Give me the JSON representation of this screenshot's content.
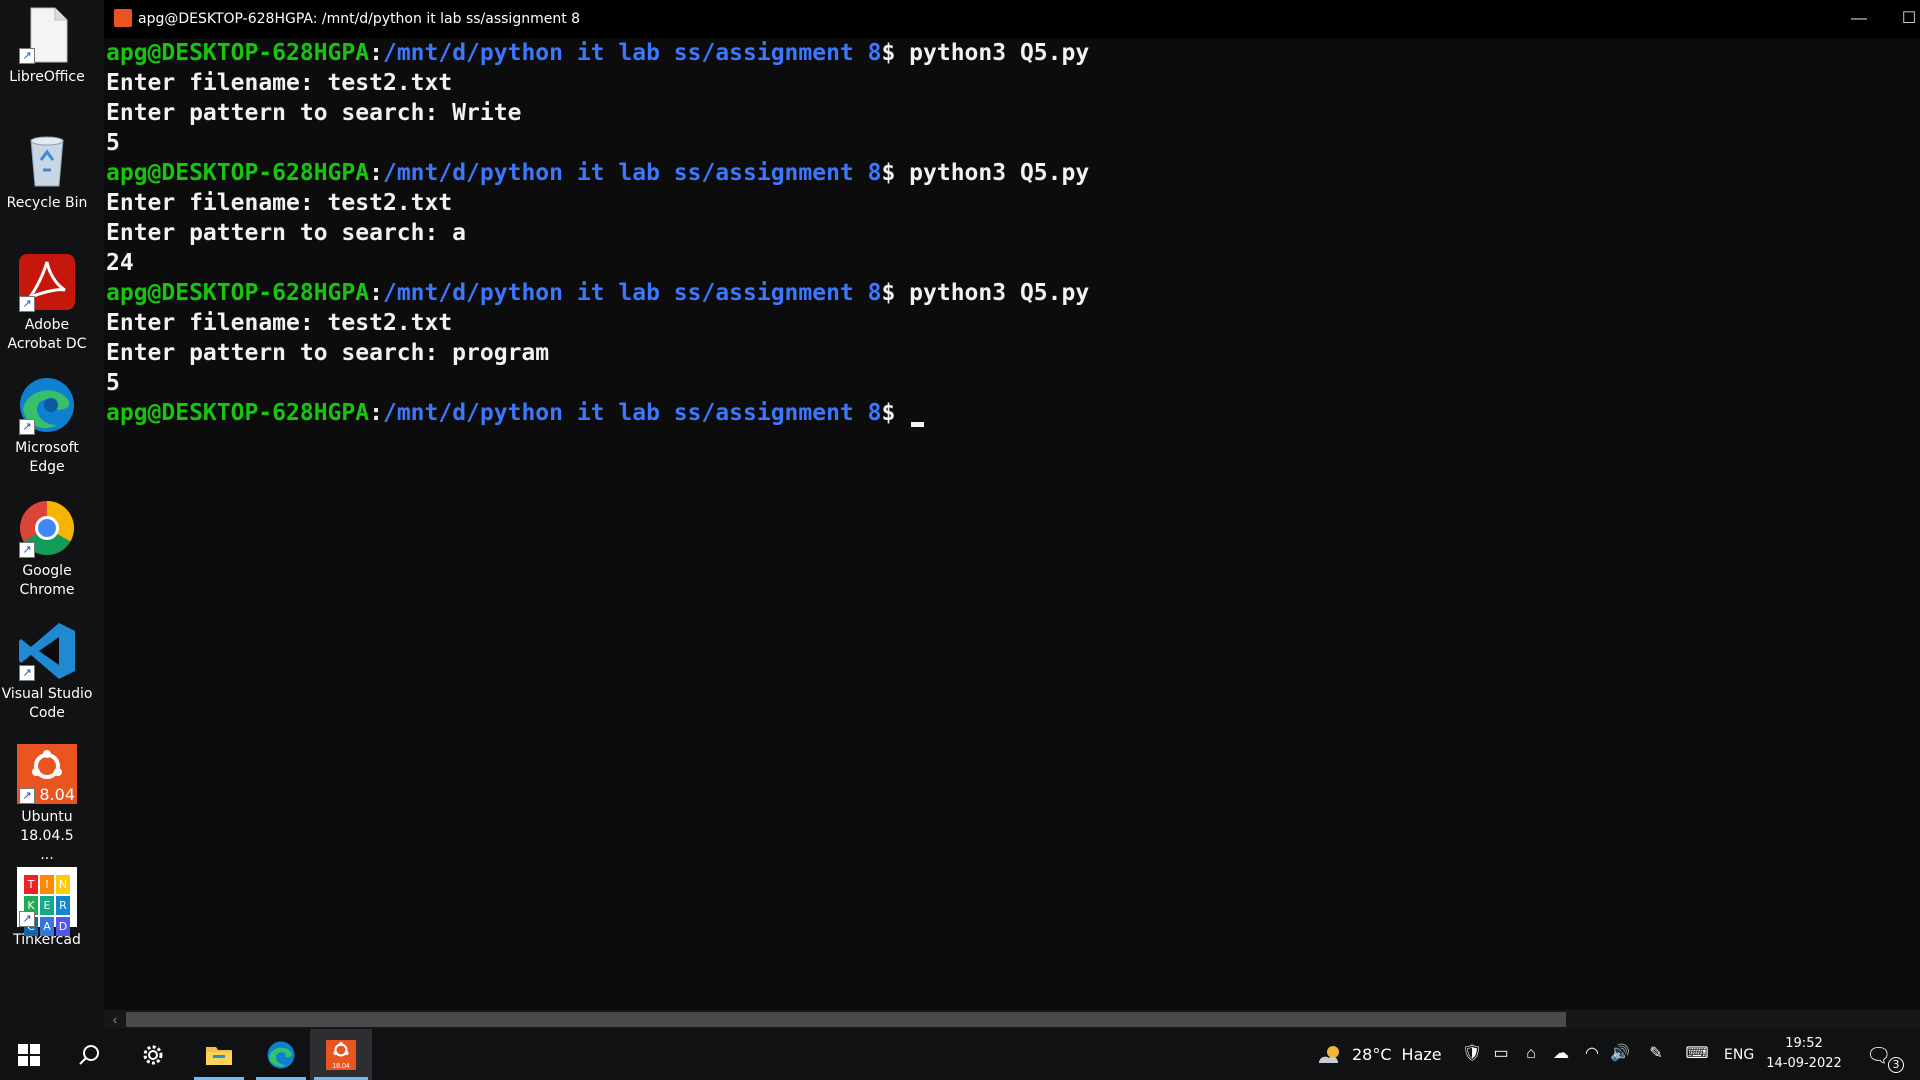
{
  "desktop": {
    "icons": [
      {
        "label": "LibreOffice",
        "icon": "libreoffice-file-icon"
      },
      {
        "label": "Recycle Bin",
        "icon": "recycle-bin-icon"
      },
      {
        "label": "Adobe Acrobat DC",
        "icon": "adobe-acrobat-icon"
      },
      {
        "label": "Microsoft Edge",
        "icon": "edge-icon"
      },
      {
        "label": "Google Chrome",
        "icon": "chrome-icon"
      },
      {
        "label": "Visual Studio Code",
        "icon": "vscode-icon"
      },
      {
        "label": "Ubuntu 18.04.5 ...",
        "icon": "ubuntu-icon",
        "badge": "8.04"
      },
      {
        "label": "Tinkercad",
        "icon": "tinkercad-icon",
        "letters": [
          "T",
          "I",
          "N",
          "K",
          "E",
          "R",
          "C",
          "A",
          "D"
        ]
      }
    ]
  },
  "window": {
    "title": "apg@DESKTOP-628HGPA: /mnt/d/python it lab ss/assignment 8",
    "minimize_glyph": "—",
    "maximize_glyph": "☐"
  },
  "terminal": {
    "prompt_user": "apg@DESKTOP-628HGPA",
    "prompt_sep": ":",
    "prompt_path": "/mnt/d/python it lab ss/assignment 8",
    "prompt_sym": "$ ",
    "command": "python3 Q5.py",
    "runs": [
      {
        "filename_line": "Enter filename: test2.txt",
        "pattern_line": "Enter pattern to search: Write",
        "result": "5"
      },
      {
        "filename_line": "Enter filename: test2.txt",
        "pattern_line": "Enter pattern to search: a",
        "result": "24"
      },
      {
        "filename_line": "Enter filename: test2.txt",
        "pattern_line": "Enter pattern to search: program",
        "result": "5"
      }
    ]
  },
  "taskbar": {
    "apps": [
      "start-icon",
      "search-icon",
      "settings-icon",
      "file-explorer-icon",
      "edge-icon",
      "ubuntu-icon"
    ],
    "ubuntu_badge": "18.04",
    "weather_temp": "28°C",
    "weather_desc": "Haze",
    "language": "ENG",
    "time": "19:52",
    "date": "14-09-2022",
    "notification_count": "3"
  },
  "colors": {
    "prompt_user": "#16c60c",
    "prompt_path": "#3b78ff",
    "terminal_bg": "#0c0c0c",
    "ubuntu_orange": "#e95420"
  }
}
